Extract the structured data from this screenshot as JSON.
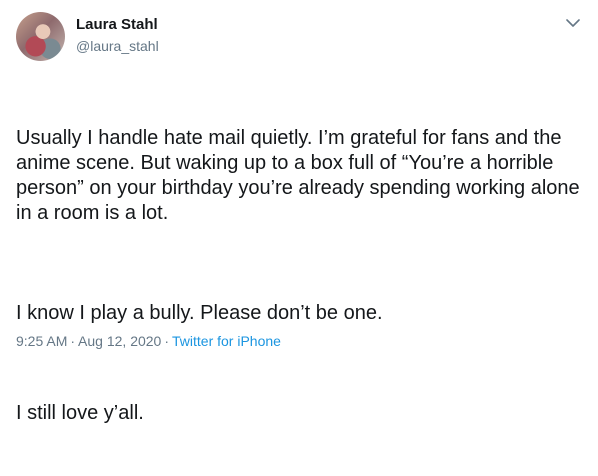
{
  "tweet": {
    "display_name": "Laura Stahl",
    "handle": "@laura_stahl",
    "paragraphs": [
      "Usually I handle hate mail quietly. I’m grateful for fans and the anime scene. But waking up to a box full of “You’re a horrible person” on your birthday you’re already spending working alone in a room is a lot.",
      "I know I play a bully. Please don’t be one.",
      "I still love y’all."
    ],
    "time": "9:25 AM",
    "separator": "·",
    "date": "Aug 12, 2020",
    "source": "Twitter for iPhone",
    "menu_icon": "chevron-down-icon",
    "colors": {
      "link": "#1b95e0",
      "muted": "#657786",
      "text": "#14171a"
    }
  }
}
